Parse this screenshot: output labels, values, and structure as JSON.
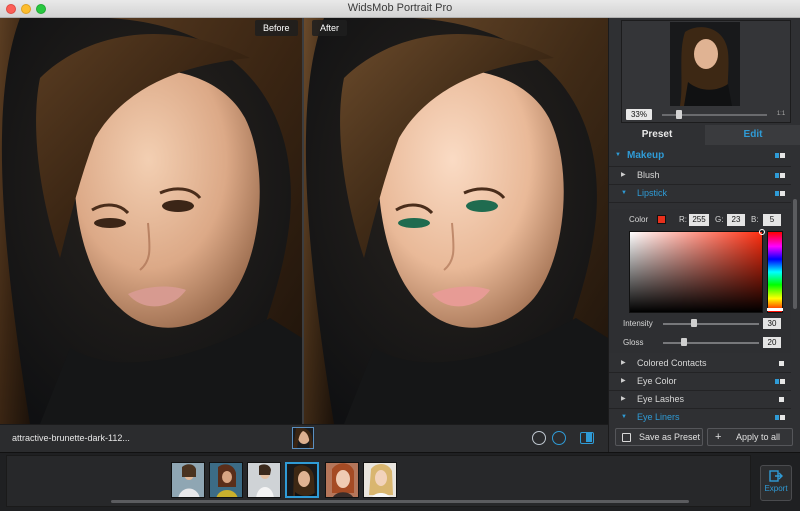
{
  "window": {
    "title": "WidsMob Portrait Pro"
  },
  "compare": {
    "before_label": "Before",
    "after_label": "After"
  },
  "footer": {
    "filename": "attractive-brunette-dark-112..."
  },
  "navigator": {
    "zoom": "33%",
    "fit": "1:1"
  },
  "tabs": [
    {
      "label": "Preset",
      "active": false
    },
    {
      "label": "Edit",
      "active": true
    }
  ],
  "sections": {
    "makeup": "Makeup",
    "blush": "Blush",
    "lipstick": "Lipstick",
    "colored_contacts": "Colored Contacts",
    "eye_color": "Eye Color",
    "eye_lashes": "Eye Lashes",
    "eye_liners": "Eye Liners"
  },
  "lipstick": {
    "color_label": "Color",
    "r_label": "R:",
    "r": "255",
    "g_label": "G:",
    "g": "23",
    "b_label": "B:",
    "b": "5",
    "intensity_label": "Intensity",
    "intensity": "30",
    "gloss_label": "Gloss",
    "gloss": "20"
  },
  "actions": {
    "save_preset": "Save as Preset",
    "apply_all": "Apply to all"
  },
  "export": {
    "label": "Export"
  },
  "colors": {
    "accent": "#2f9bd6",
    "swatch": "#e8301c"
  }
}
